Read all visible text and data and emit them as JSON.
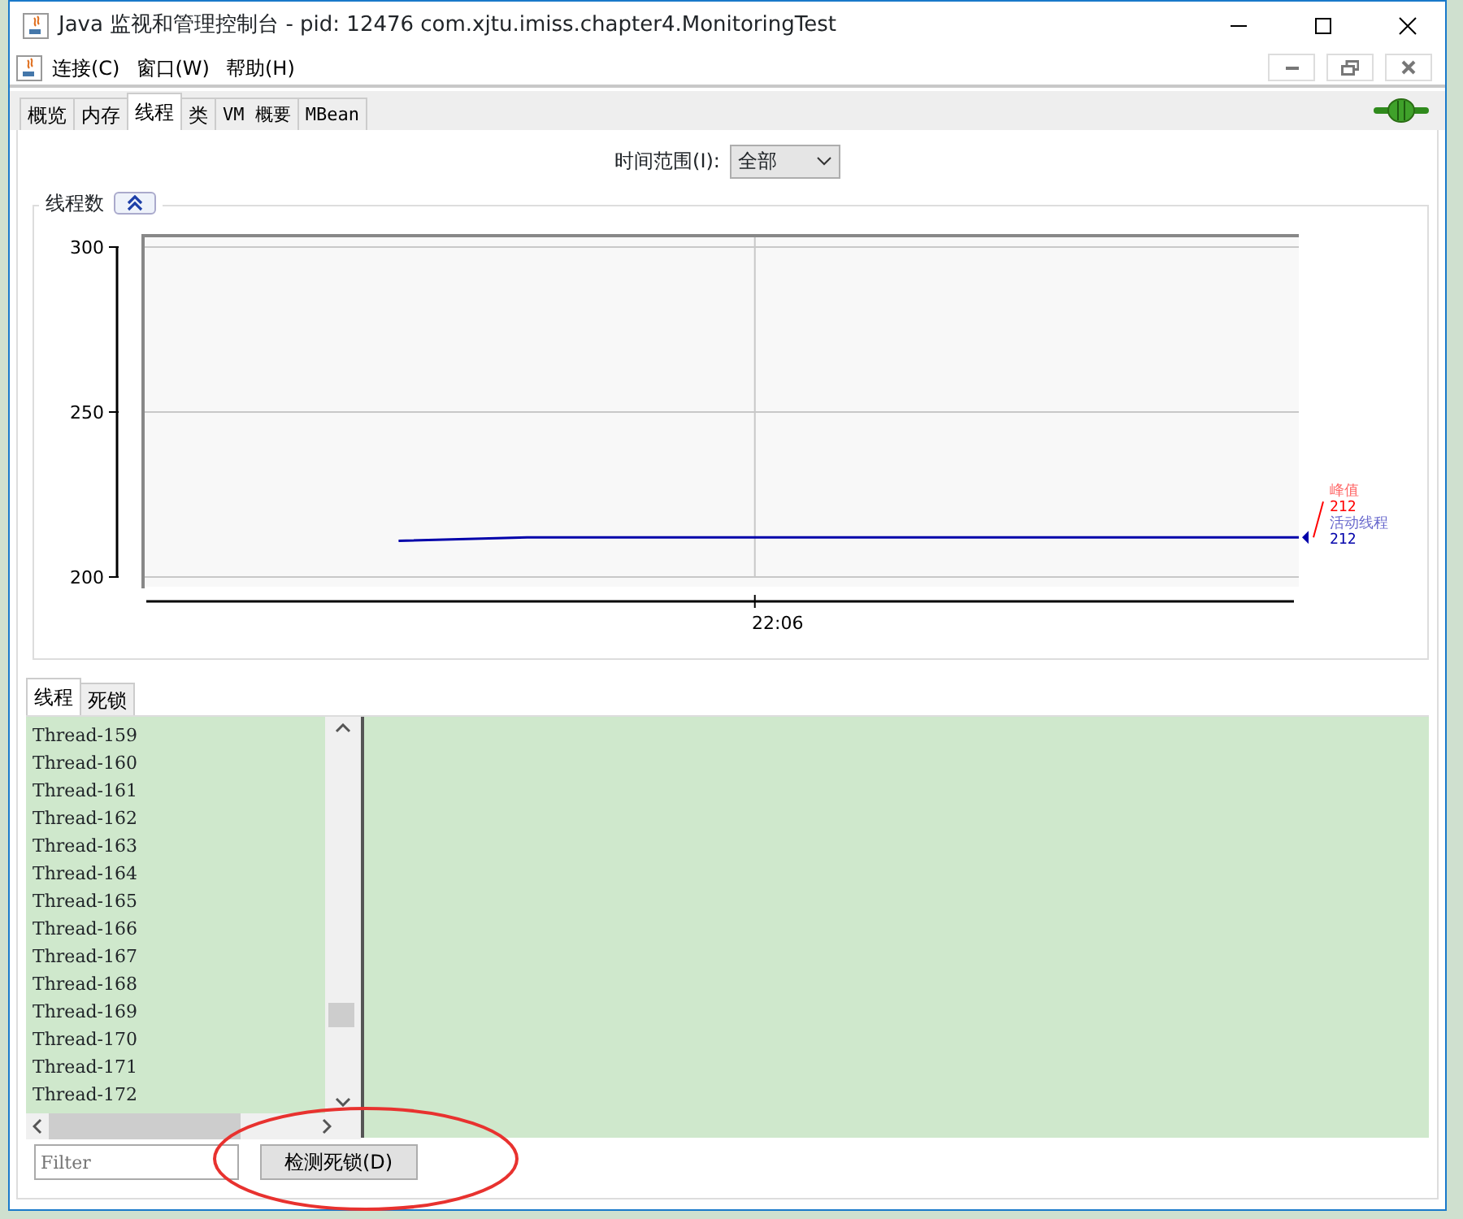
{
  "window": {
    "title": "Java 监视和管理控制台 - pid: 12476 com.xjtu.imiss.chapter4.MonitoringTest"
  },
  "menu": [
    "连接(C)",
    "窗口(W)",
    "帮助(H)"
  ],
  "tabs": [
    {
      "label": "概览",
      "selected": false
    },
    {
      "label": "内存",
      "selected": false
    },
    {
      "label": "线程",
      "selected": true
    },
    {
      "label": "类",
      "selected": false
    },
    {
      "label": "VM 概要",
      "selected": false
    },
    {
      "label": "MBean",
      "selected": false
    }
  ],
  "time_range": {
    "label": "时间范围(I):",
    "value": "全部"
  },
  "thread_chart": {
    "title": "线程数",
    "expanded": true,
    "chart_data": {
      "type": "line",
      "ylim": [
        200,
        300
      ],
      "yticks": [
        {
          "value": 200,
          "label": "200"
        },
        {
          "value": 250,
          "label": "250"
        },
        {
          "value": 300,
          "label": "300"
        }
      ],
      "annotations": [
        "22:06"
      ],
      "series": [
        {
          "name": "活动线程",
          "color": "#0000aa",
          "values": [
            null,
            null,
            211,
            212,
            212,
            212,
            212,
            212,
            212,
            212
          ]
        }
      ]
    },
    "peak": {
      "label": "峰值",
      "value": "212"
    },
    "current_value": "212"
  },
  "lower_tabs": [
    {
      "label": "线程",
      "selected": true
    },
    {
      "label": "死锁",
      "selected": false
    }
  ],
  "thread_list": [
    "Thread-159",
    "Thread-160",
    "Thread-161",
    "Thread-162",
    "Thread-163",
    "Thread-164",
    "Thread-165",
    "Thread-166",
    "Thread-167",
    "Thread-168",
    "Thread-169",
    "Thread-170",
    "Thread-171",
    "Thread-172"
  ],
  "filter": {
    "placeholder": "Filter"
  },
  "detect_button": "检测死锁(D)"
}
